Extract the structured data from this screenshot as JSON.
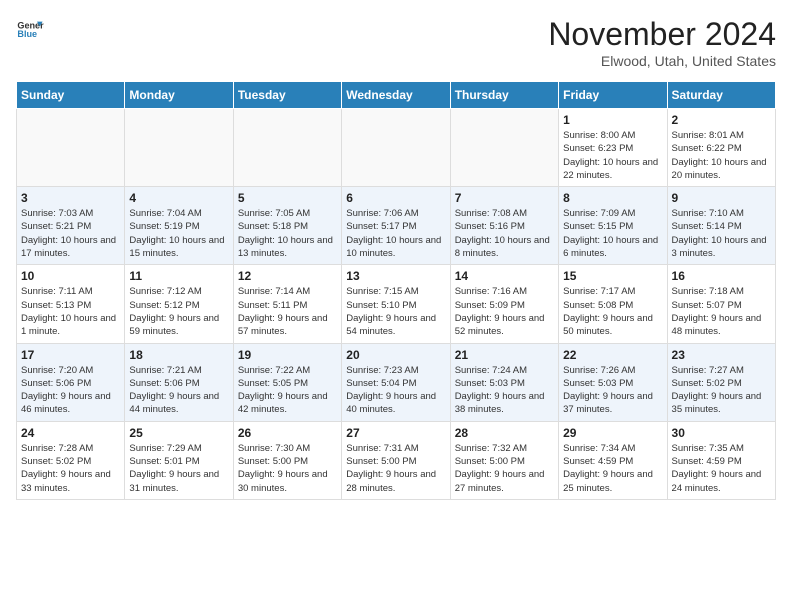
{
  "header": {
    "logo": {
      "general": "General",
      "blue": "Blue"
    },
    "title": "November 2024",
    "location": "Elwood, Utah, United States"
  },
  "days_of_week": [
    "Sunday",
    "Monday",
    "Tuesday",
    "Wednesday",
    "Thursday",
    "Friday",
    "Saturday"
  ],
  "weeks": [
    [
      {
        "day": "",
        "info": ""
      },
      {
        "day": "",
        "info": ""
      },
      {
        "day": "",
        "info": ""
      },
      {
        "day": "",
        "info": ""
      },
      {
        "day": "",
        "info": ""
      },
      {
        "day": "1",
        "info": "Sunrise: 8:00 AM\nSunset: 6:23 PM\nDaylight: 10 hours and 22 minutes."
      },
      {
        "day": "2",
        "info": "Sunrise: 8:01 AM\nSunset: 6:22 PM\nDaylight: 10 hours and 20 minutes."
      }
    ],
    [
      {
        "day": "3",
        "info": "Sunrise: 7:03 AM\nSunset: 5:21 PM\nDaylight: 10 hours and 17 minutes."
      },
      {
        "day": "4",
        "info": "Sunrise: 7:04 AM\nSunset: 5:19 PM\nDaylight: 10 hours and 15 minutes."
      },
      {
        "day": "5",
        "info": "Sunrise: 7:05 AM\nSunset: 5:18 PM\nDaylight: 10 hours and 13 minutes."
      },
      {
        "day": "6",
        "info": "Sunrise: 7:06 AM\nSunset: 5:17 PM\nDaylight: 10 hours and 10 minutes."
      },
      {
        "day": "7",
        "info": "Sunrise: 7:08 AM\nSunset: 5:16 PM\nDaylight: 10 hours and 8 minutes."
      },
      {
        "day": "8",
        "info": "Sunrise: 7:09 AM\nSunset: 5:15 PM\nDaylight: 10 hours and 6 minutes."
      },
      {
        "day": "9",
        "info": "Sunrise: 7:10 AM\nSunset: 5:14 PM\nDaylight: 10 hours and 3 minutes."
      }
    ],
    [
      {
        "day": "10",
        "info": "Sunrise: 7:11 AM\nSunset: 5:13 PM\nDaylight: 10 hours and 1 minute."
      },
      {
        "day": "11",
        "info": "Sunrise: 7:12 AM\nSunset: 5:12 PM\nDaylight: 9 hours and 59 minutes."
      },
      {
        "day": "12",
        "info": "Sunrise: 7:14 AM\nSunset: 5:11 PM\nDaylight: 9 hours and 57 minutes."
      },
      {
        "day": "13",
        "info": "Sunrise: 7:15 AM\nSunset: 5:10 PM\nDaylight: 9 hours and 54 minutes."
      },
      {
        "day": "14",
        "info": "Sunrise: 7:16 AM\nSunset: 5:09 PM\nDaylight: 9 hours and 52 minutes."
      },
      {
        "day": "15",
        "info": "Sunrise: 7:17 AM\nSunset: 5:08 PM\nDaylight: 9 hours and 50 minutes."
      },
      {
        "day": "16",
        "info": "Sunrise: 7:18 AM\nSunset: 5:07 PM\nDaylight: 9 hours and 48 minutes."
      }
    ],
    [
      {
        "day": "17",
        "info": "Sunrise: 7:20 AM\nSunset: 5:06 PM\nDaylight: 9 hours and 46 minutes."
      },
      {
        "day": "18",
        "info": "Sunrise: 7:21 AM\nSunset: 5:06 PM\nDaylight: 9 hours and 44 minutes."
      },
      {
        "day": "19",
        "info": "Sunrise: 7:22 AM\nSunset: 5:05 PM\nDaylight: 9 hours and 42 minutes."
      },
      {
        "day": "20",
        "info": "Sunrise: 7:23 AM\nSunset: 5:04 PM\nDaylight: 9 hours and 40 minutes."
      },
      {
        "day": "21",
        "info": "Sunrise: 7:24 AM\nSunset: 5:03 PM\nDaylight: 9 hours and 38 minutes."
      },
      {
        "day": "22",
        "info": "Sunrise: 7:26 AM\nSunset: 5:03 PM\nDaylight: 9 hours and 37 minutes."
      },
      {
        "day": "23",
        "info": "Sunrise: 7:27 AM\nSunset: 5:02 PM\nDaylight: 9 hours and 35 minutes."
      }
    ],
    [
      {
        "day": "24",
        "info": "Sunrise: 7:28 AM\nSunset: 5:02 PM\nDaylight: 9 hours and 33 minutes."
      },
      {
        "day": "25",
        "info": "Sunrise: 7:29 AM\nSunset: 5:01 PM\nDaylight: 9 hours and 31 minutes."
      },
      {
        "day": "26",
        "info": "Sunrise: 7:30 AM\nSunset: 5:00 PM\nDaylight: 9 hours and 30 minutes."
      },
      {
        "day": "27",
        "info": "Sunrise: 7:31 AM\nSunset: 5:00 PM\nDaylight: 9 hours and 28 minutes."
      },
      {
        "day": "28",
        "info": "Sunrise: 7:32 AM\nSunset: 5:00 PM\nDaylight: 9 hours and 27 minutes."
      },
      {
        "day": "29",
        "info": "Sunrise: 7:34 AM\nSunset: 4:59 PM\nDaylight: 9 hours and 25 minutes."
      },
      {
        "day": "30",
        "info": "Sunrise: 7:35 AM\nSunset: 4:59 PM\nDaylight: 9 hours and 24 minutes."
      }
    ]
  ]
}
